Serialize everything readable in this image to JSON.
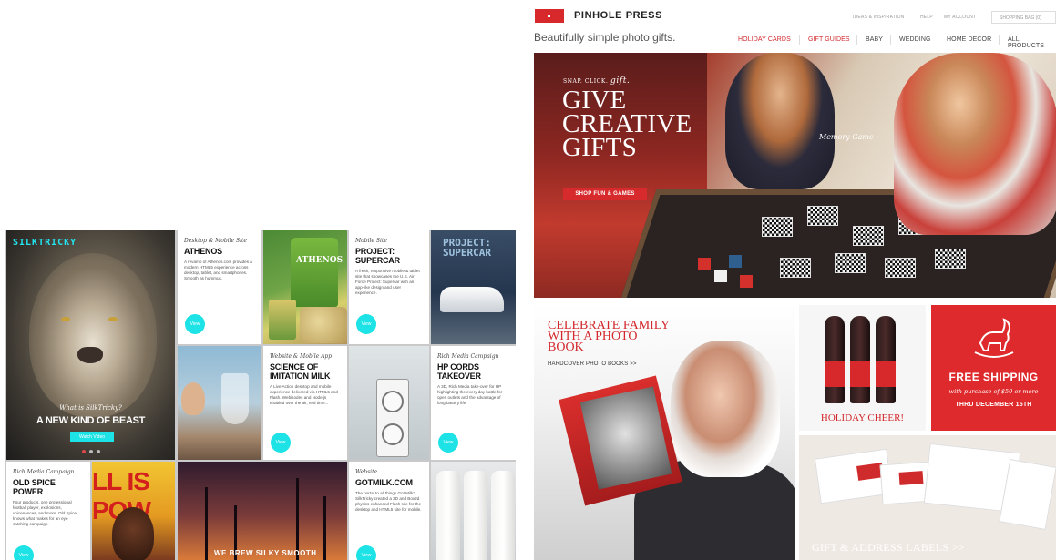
{
  "left_portfolio": {
    "lion_tile": {
      "logo": "SILKTRICKY",
      "question": "What is SilkTricky?",
      "headline": "A NEW KIND OF BEAST",
      "button": "Watch Video"
    },
    "cards": [
      {
        "category": "Desktop & Mobile Site",
        "title": "ATHENOS",
        "description": "A revamp of Athenos.com provides a modern HTML5 experience across desktop, tablet, and smartphones. Smooth as hummus.",
        "button": "View"
      },
      {
        "category": "Mobile Site",
        "title": "PROJECT: SUPERCAR",
        "description": "A fresh, responsive mobile & tablet site that showcases the U.S. Air Force Project: Supercar with an app-like design and user experience.",
        "button": "View"
      },
      {
        "category": "Website & Mobile App",
        "title": "SCIENCE OF IMITATION MILK",
        "description": "A Live Action desktop and mobile experience delivered via HTML5 and Flash. Webisodes and Node.js enabled over the air, real time...",
        "button": "View"
      },
      {
        "category": "Rich Media Campaign",
        "title": "HP CORDS TAKEOVER",
        "description": "A 3D, Rich Media take-over for HP highlighting the every day battle for open outlets and the advantage of long battery life.",
        "button": "View"
      },
      {
        "category": "Rich Media Campaign",
        "title": "OLD SPICE POWER",
        "description": "Four products, one professional football player, explosions, voicenances, and more. Old Spice knows what makes for an eye catching campaign.",
        "button": "View"
      },
      {
        "category": "Website",
        "title": "GOTMILK.COM",
        "description": "The portal to all things Got Milk? SilkTricky created a 3D and Box2d physics enhanced Flash site for the desktop and HTML5 site for mobile.",
        "button": "View"
      }
    ],
    "image_texts": {
      "athenos_bag": "ATHENOS",
      "supercar": "PROJECT:\nSUPERCAR",
      "old_spice": "LL IS POW",
      "palm": "WE BREW SILKY SMOOTH"
    }
  },
  "pinhole": {
    "brand": "PINHOLE PRESS",
    "tagline": "Beautifully simple photo gifts.",
    "utility": [
      "IDEAS & INSPIRATION",
      "HELP",
      "MY ACCOUNT"
    ],
    "shopping_bag": "SHOPPING BAG (0)",
    "nav": [
      {
        "label": "HOLIDAY CARDS",
        "active": true
      },
      {
        "label": "GIFT GUIDES",
        "active": true
      },
      {
        "label": "BABY",
        "active": false
      },
      {
        "label": "WEDDING",
        "active": false
      },
      {
        "label": "HOME DECOR",
        "active": false
      },
      {
        "label": "ALL PRODUCTS",
        "active": false
      }
    ],
    "hero": {
      "kicker_prefix": "SNAP. CLICK.",
      "kicker_gift": "gift.",
      "headline_lines": [
        "GIVE",
        "CREATIVE",
        "GIFTS"
      ],
      "button": "SHOP FUN & GAMES",
      "callout": "Memory Game ›"
    },
    "photo_book": {
      "headline_lines": [
        "CELEBRATE FAMILY",
        "WITH A PHOTO",
        "BOOK"
      ],
      "link": "HARDCOVER PHOTO BOOKS >>"
    },
    "wine": {
      "caption": "HOLIDAY CHEER!"
    },
    "shipping": {
      "headline": "FREE SHIPPING",
      "subline": "with purchase of $50 or more",
      "date_line": "THRU DECEMBER 15TH"
    },
    "labels": {
      "caption": "GIFT & ADDRESS LABELS >>"
    },
    "colors": {
      "brand_red": "#d7282b",
      "accent_cyan": "#1de2e6"
    }
  }
}
